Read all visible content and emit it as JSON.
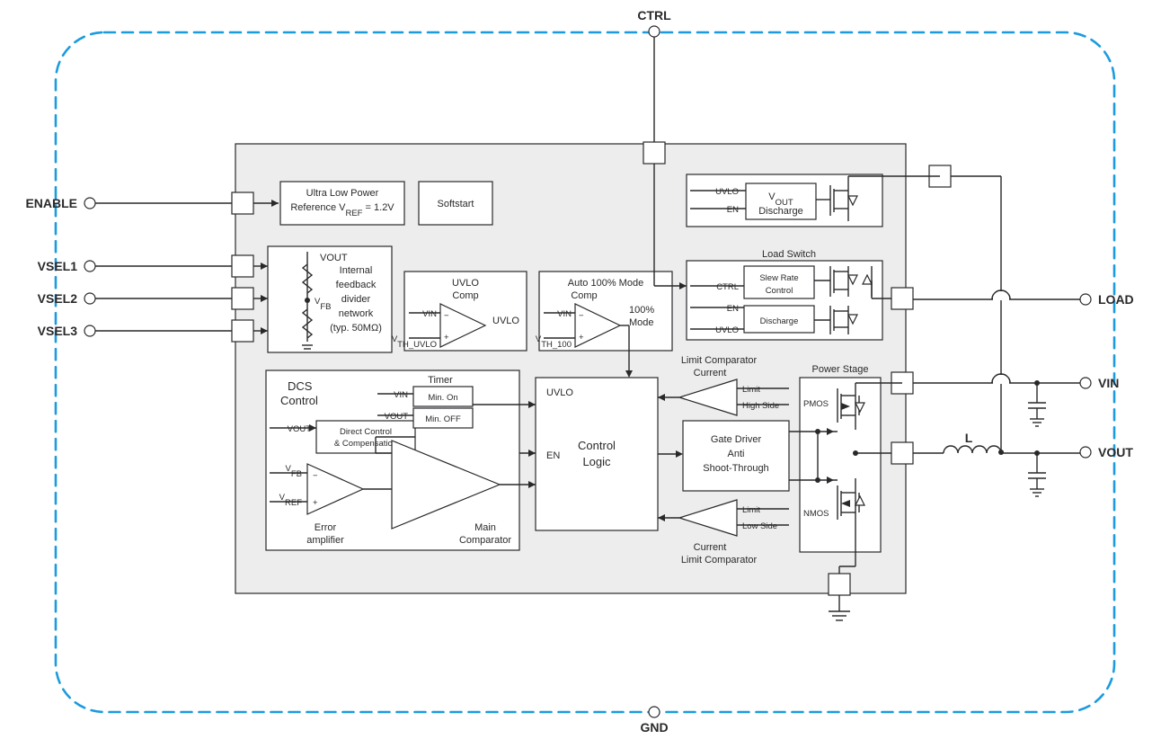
{
  "pins": {
    "ctrl": "CTRL",
    "enable": "ENABLE",
    "vsel1": "VSEL1",
    "vsel2": "VSEL2",
    "vsel3": "VSEL3",
    "gnd": "GND",
    "load": "LOAD",
    "vin": "VIN",
    "vout": "VOUT"
  },
  "blocks": {
    "ref_line1": "Ultra Low Power",
    "ref_line2": "Reference V",
    "ref_sub": "REF",
    "ref_line2b": " = 1.2V",
    "softstart": "Softstart",
    "fb_vout": "VOUT",
    "fb_vfb": "V",
    "fb_vfb_sub": "FB",
    "fb_l1": "Internal",
    "fb_l2": "feedback",
    "fb_l3": "divider",
    "fb_l4": "network",
    "fb_l5": "(typ. 50MΩ)",
    "uvlo_title": "UVLO",
    "uvlo_title2": "Comp",
    "uvlo_vin": "VIN",
    "uvlo_vth": "V",
    "uvlo_vth_sub": "TH_UVLO",
    "uvlo_out": "UVLO",
    "auto_title": "Auto 100% Mode",
    "auto_title2": "Comp",
    "auto_vin": "VIN",
    "auto_vth": "V",
    "auto_vth_sub": "TH_100",
    "auto_out1": "100%",
    "auto_out2": "Mode",
    "dcs_title1": "DCS",
    "dcs_title2": "Control",
    "dcs_vout": "VOUT",
    "dcs_dc1": "Direct Control",
    "dcs_dc2": "& Compensation",
    "dcs_vfb": "V",
    "dcs_vfb_sub": "FB",
    "dcs_vref": "V",
    "dcs_vref_sub": "REF",
    "dcs_err1": "Error",
    "dcs_err2": "amplifier",
    "dcs_timer": "Timer",
    "dcs_t_vin": "VIN",
    "dcs_t_vout": "VOUT",
    "dcs_min_on": "Min. On",
    "dcs_min_off": "Min. OFF",
    "dcs_main1": "Main",
    "dcs_main2": "Comparator",
    "ctrl_uvlo": "UVLO",
    "ctrl_en": "EN",
    "ctrl_logic1": "Control",
    "ctrl_logic2": "Logic",
    "cl_hs1": "Current",
    "cl_hs2": "Limit Comparator",
    "cl_hs_in1": "Limit",
    "cl_hs_in2": "High Side",
    "cl_ls_in1": "Limit",
    "cl_ls_in2": "Low Side",
    "cl_ls1": "Current",
    "cl_ls2": "Limit Comparator",
    "gate1": "Gate Driver",
    "gate2": "Anti",
    "gate3": "Shoot-Through",
    "ps_title": "Power Stage",
    "ps_pmos": "PMOS",
    "ps_nmos": "NMOS",
    "disch_uvlo": "UVLO",
    "disch_en": "EN",
    "disch_v": "V",
    "disch_v_sub": "OUT",
    "disch_label": "Discharge",
    "ls_title": "Load Switch",
    "ls_ctrl": "CTRL",
    "ls_en": "EN",
    "ls_uvlo": "UVLO",
    "ls_slew1": "Slew Rate",
    "ls_slew2": "Control",
    "ls_disch": "Discharge",
    "L": "L"
  }
}
